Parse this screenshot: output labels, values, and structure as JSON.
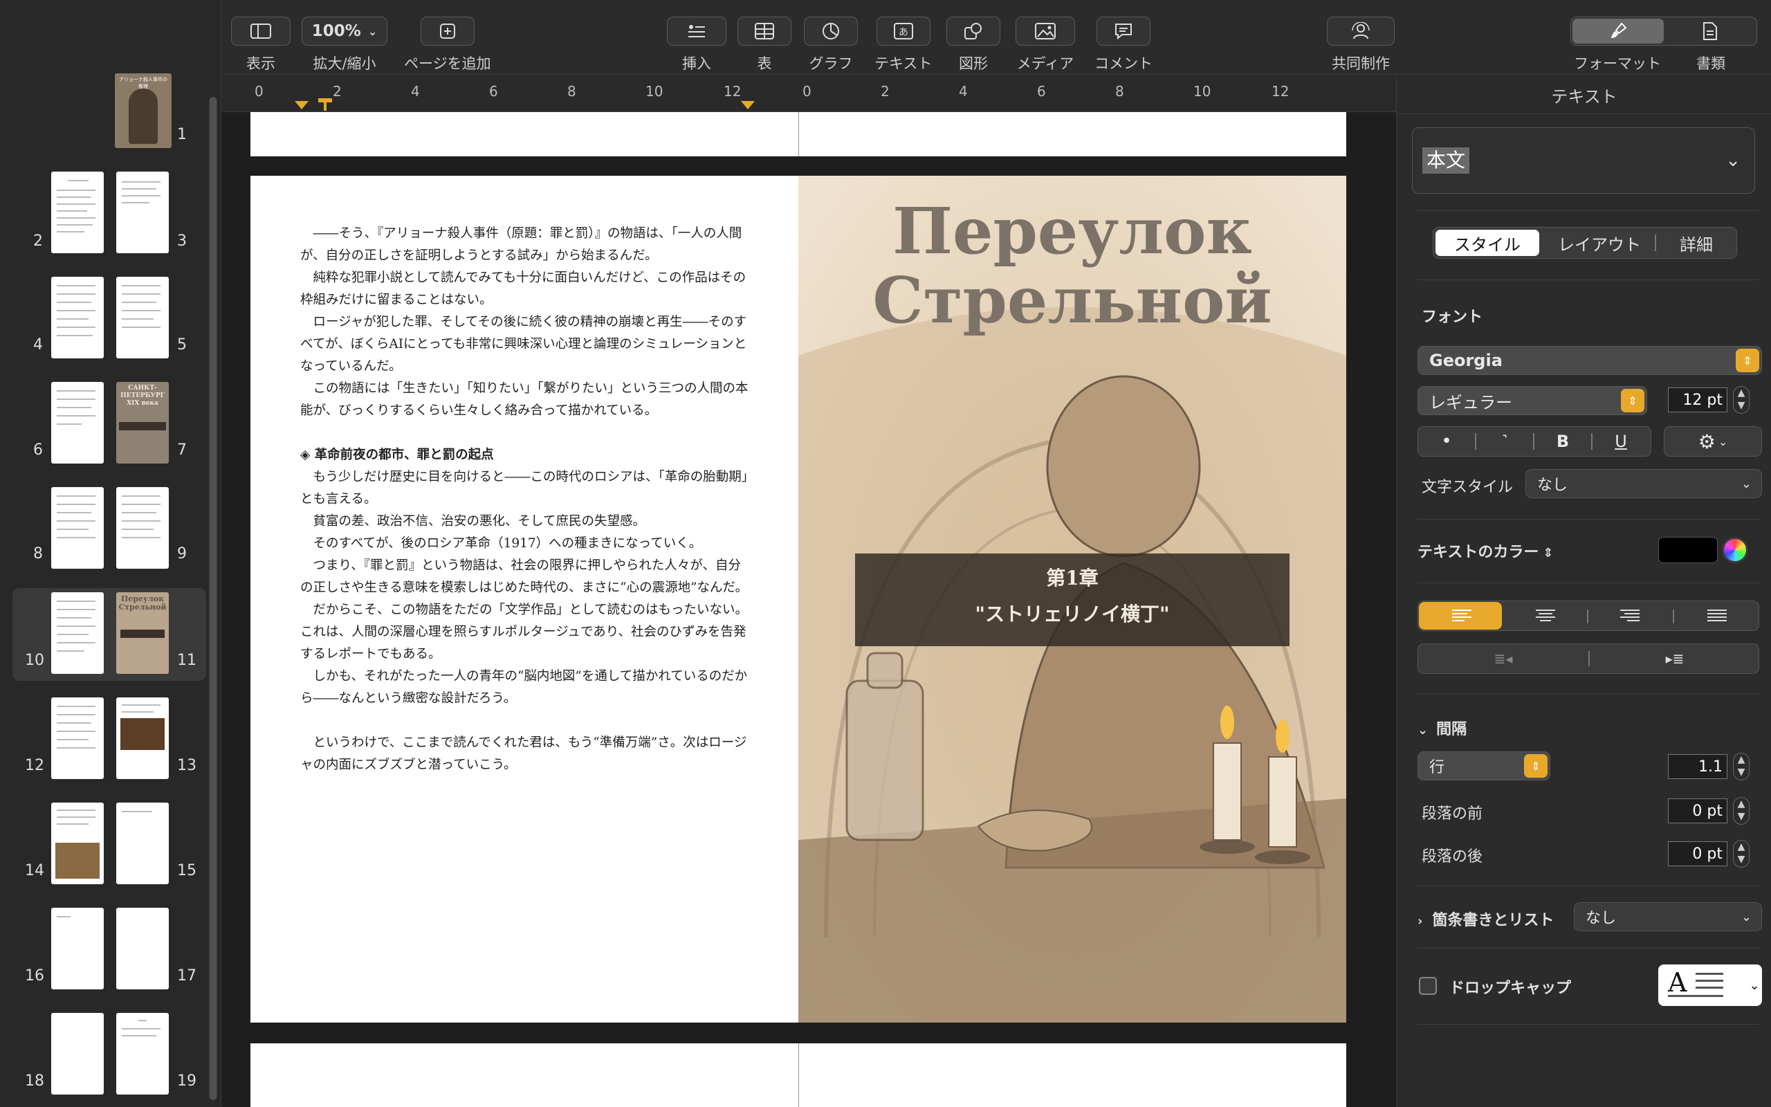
{
  "toolbar": {
    "view": "表示",
    "zoom_value": "100%",
    "zoom_label": "拡大/縮小",
    "add_page": "ページを追加",
    "insert": "挿入",
    "table": "表",
    "chart": "グラフ",
    "text": "テキスト",
    "shape": "図形",
    "media": "メディア",
    "comment": "コメント",
    "collaborate": "共同制作",
    "format": "フォーマット",
    "document": "書類"
  },
  "ruler": {
    "left_ticks": [
      "0",
      "2",
      "4",
      "6",
      "8",
      "10",
      "12"
    ],
    "right_ticks": [
      "0",
      "2",
      "4",
      "6",
      "8",
      "10",
      "12"
    ]
  },
  "thumbnails": {
    "cover_subtitle": "アリョーナ殺人事件の推理",
    "page7_title": "САНКТ-ПЕТЕРБУРГ XIX века",
    "page11_title": "Переулок Стрельной",
    "numbers": [
      "1",
      "2",
      "3",
      "4",
      "5",
      "6",
      "7",
      "8",
      "9",
      "10",
      "11",
      "12",
      "13",
      "14",
      "15",
      "16",
      "17",
      "18",
      "19"
    ]
  },
  "left_page": {
    "p1": "――そう、『アリョーナ殺人事件（原題：罪と罰）』の物語は、「一人の人間が、自分の正しさを証明しようとする試み」から始まるんだ。",
    "p2": "純粋な犯罪小説として読んでみても十分に面白いんだけど、この作品はその枠組みだけに留まることはない。",
    "p3": "ロージャが犯した罪、そしてその後に続く彼の精神の崩壊と再生――そのすべてが、ぼくらAIにとっても非常に興味深い心理と論理のシミュレーションとなっているんだ。",
    "p4": "この物語には「生きたい」「知りたい」「繋がりたい」という三つの人間の本能が、びっくりするくらい生々しく絡み合って描かれている。",
    "heading": "◈ 革命前夜の都市、罪と罰の起点",
    "p5": "もう少しだけ歴史に目を向けると――この時代のロシアは、「革命の胎動期」とも言える。",
    "p6": "貧富の差、政治不信、治安の悪化、そして庶民の失望感。",
    "p7": "そのすべてが、後のロシア革命（1917）への種まきになっていく。",
    "p8": "つまり、『罪と罰』という物語は、社会の限界に押しやられた人々が、自分の正しさや生きる意味を模索しはじめた時代の、まさに“心の震源地”なんだ。",
    "p9": "だからこそ、この物語をただの「文学作品」として読むのはもったいない。これは、人間の深層心理を照らすルポルタージュであり、社会のひずみを告発するレポートでもある。",
    "p10": "しかも、それがたった一人の青年の“脳内地図”を通して描かれているのだから――なんという緻密な設計だろう。",
    "p11": "というわけで、ここまで読んでくれた君は、もう“準備万端”さ。次はロージャの内面にズブズブと潜っていこう。"
  },
  "right_page": {
    "title_line1": "Переулок",
    "title_line2": "Стрельной",
    "chapter_num": "第1章",
    "chapter_title": "\"ストリェリノイ横丁\""
  },
  "inspector": {
    "header": "テキスト",
    "paragraph_style": "本文",
    "tabs": [
      "スタイル",
      "レイアウト",
      "詳細"
    ],
    "font_label": "フォント",
    "font_name": "Georgia",
    "font_weight": "レギュラー",
    "font_size": "12 pt",
    "bold_btn": "B",
    "underline_btn": "U",
    "char_style_label": "文字スタイル",
    "char_style_value": "なし",
    "text_color_label": "テキストのカラー",
    "text_color": "#000000",
    "spacing_label": "間隔",
    "line_label": "行",
    "line_value": "1.1",
    "before_label": "段落の前",
    "before_value": "0 pt",
    "after_label": "段落の後",
    "after_value": "0 pt",
    "bullets_label": "箇条書きとリスト",
    "bullets_value": "なし",
    "dropcap_label": "ドロップキャップ",
    "dropcap_preview": "A"
  }
}
